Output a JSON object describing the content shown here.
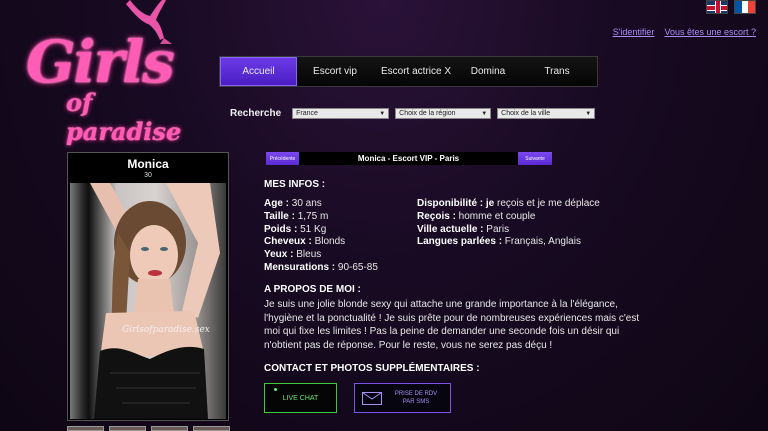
{
  "brand": {
    "name": "Girls",
    "sub": "of paradise"
  },
  "top_links": {
    "login": "S'identifier",
    "become": "Vous êtes une escort ?"
  },
  "flags": [
    "flag-uk-icon",
    "flag-fr-icon"
  ],
  "nav": {
    "items": [
      {
        "label": "Accueil",
        "active": true
      },
      {
        "label": "Escort vip"
      },
      {
        "label": "Escort actrice X"
      },
      {
        "label": "Domina"
      },
      {
        "label": "Trans"
      }
    ]
  },
  "search": {
    "label": "Recherche",
    "country": "France",
    "region": "Choix de la région",
    "city": "Choix de la ville"
  },
  "profile": {
    "name": "Monica",
    "age": "30",
    "watermark": "Girlsofparadise.sex",
    "prev": "Précédente",
    "next": "Suivante",
    "title": "Monica - Escort VIP - Paris"
  },
  "infos": {
    "title": "MES INFOS :",
    "left": [
      {
        "label": "Age :",
        "value": " 30 ans"
      },
      {
        "label": "Taille :",
        "value": " 1,75 m"
      },
      {
        "label": "Poids :",
        "value": " 51 Kg"
      },
      {
        "label": "Cheveux :",
        "value": " Blonds"
      },
      {
        "label": "Yeux :",
        "value": " Bleus"
      },
      {
        "label": "Mensurations :",
        "value": " 90-65-85"
      }
    ],
    "right": [
      {
        "label": "Disponibilité : je",
        "value": " reçois et je me déplace"
      },
      {
        "label": "Reçois :",
        "value": " homme et couple"
      },
      {
        "label": "Ville actuelle :",
        "value": " Paris"
      },
      {
        "label": "Langues parlées :",
        "value": " Français, Anglais"
      }
    ]
  },
  "about": {
    "title": "A PROPOS DE MOI :",
    "text": "Je suis une jolie blonde sexy qui attache une grande importance à la l'élégance, l'hygiène et la ponctualité ! Je suis prête pour de nombreuses expériences mais c'est moi qui fixe les limites ! Pas la peine de demander une seconde fois un désir qui n'obtient pas de réponse. Pour le reste, vous ne serez pas déçu !"
  },
  "contact": {
    "title": "CONTACT ET PHOTOS SUPPLÉMENTAIRES :",
    "chat": "LIVE CHAT",
    "sms_line1": "PRISE DE RDV",
    "sms_line2": "PAR SMS"
  },
  "colors": {
    "brand_pink": "#ff5cb6",
    "accent_purple": "#5a2ad3",
    "chat_green": "#3fc93f"
  }
}
